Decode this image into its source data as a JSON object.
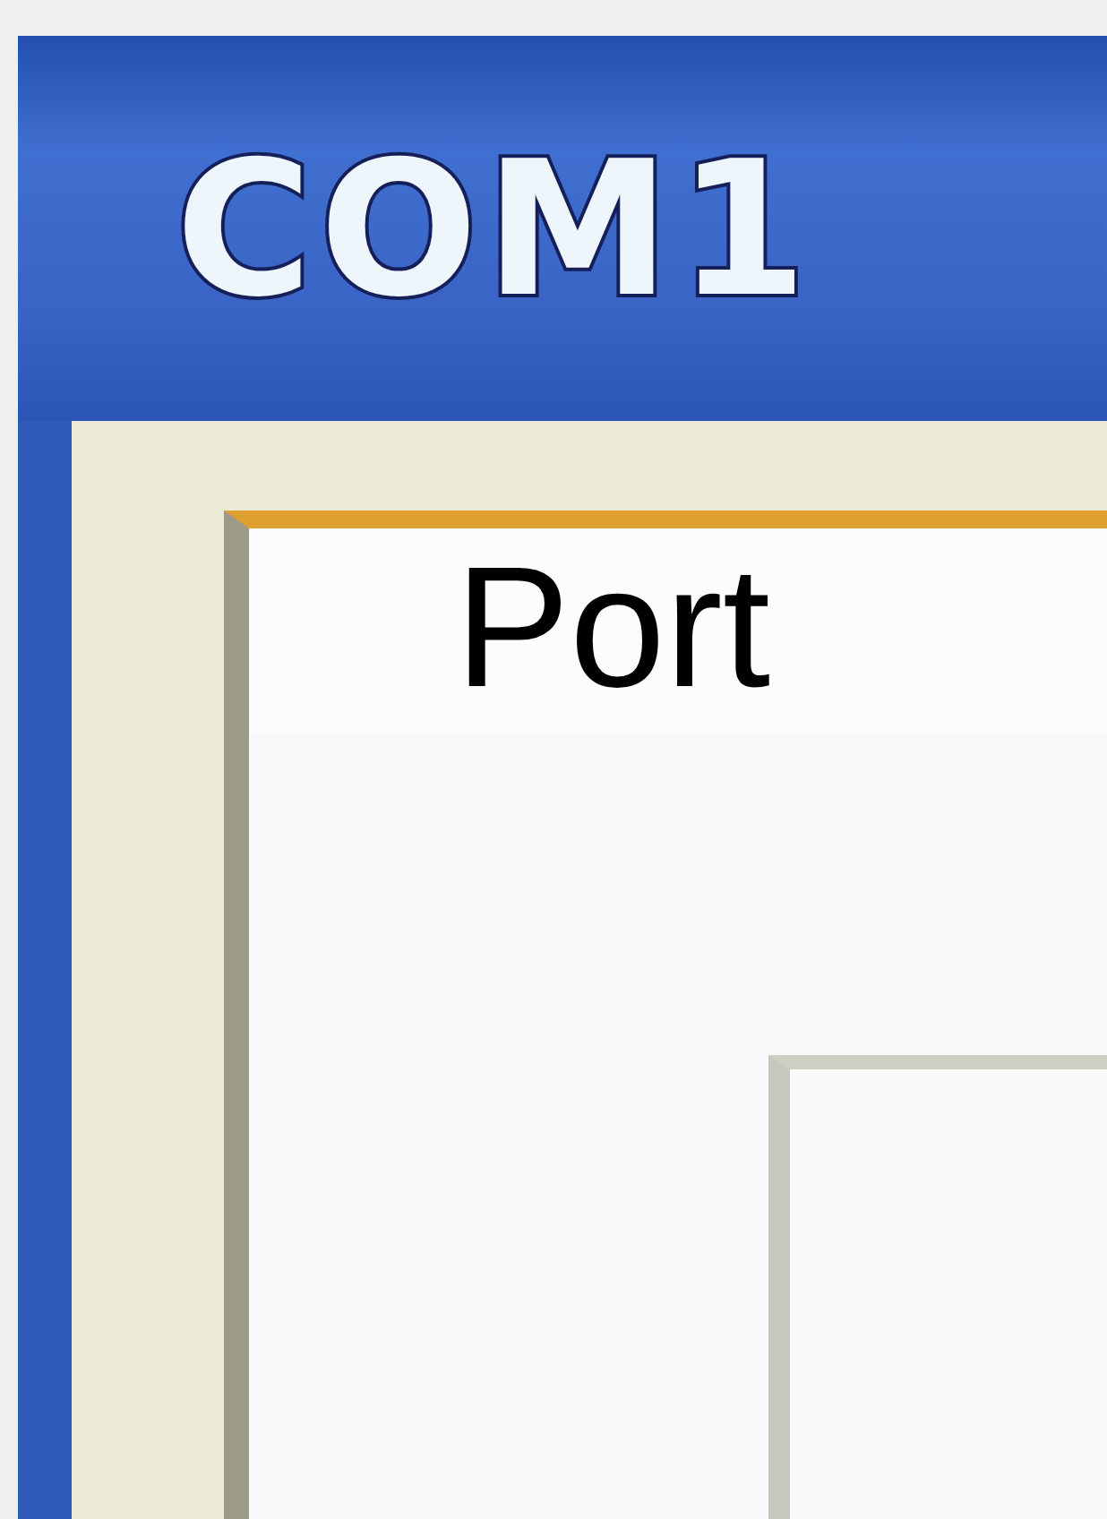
{
  "window": {
    "title": "COM1"
  },
  "tabs": [
    {
      "label": "Port",
      "selected": true
    }
  ]
}
